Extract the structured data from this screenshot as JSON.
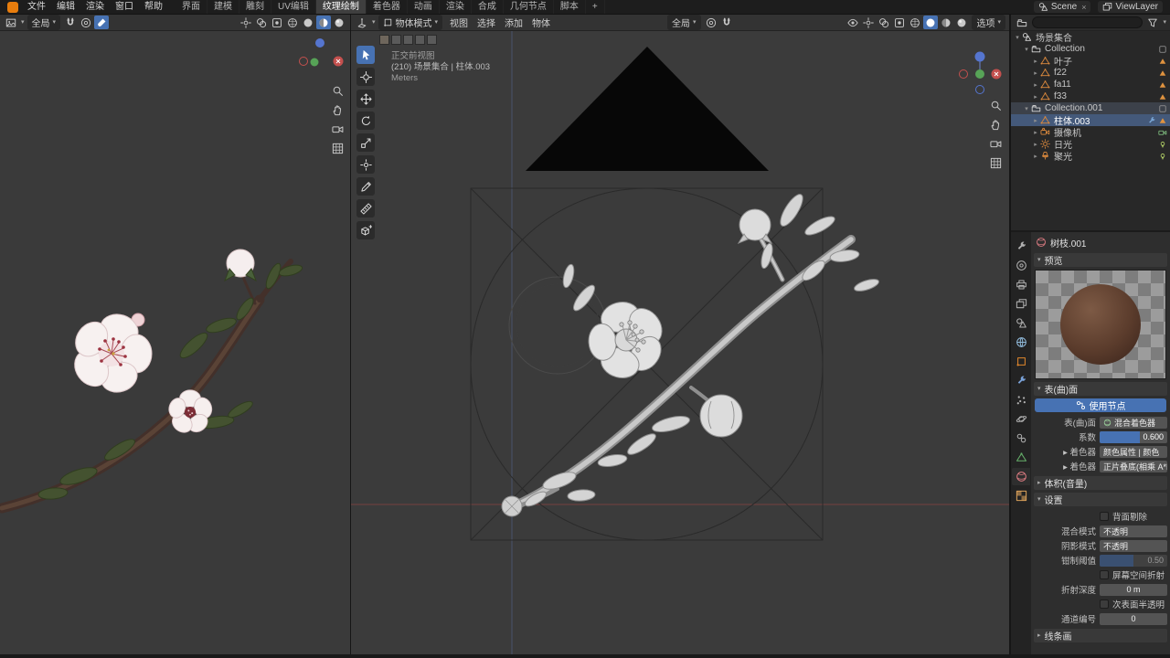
{
  "topbar": {
    "menus": [
      "文件",
      "编辑",
      "渲染",
      "窗口",
      "帮助"
    ],
    "workspaces": [
      "界面",
      "建模",
      "雕刻",
      "UV编辑",
      "纹理绘制",
      "着色器",
      "动画",
      "渲染",
      "合成",
      "几何节点",
      "脚本",
      "+"
    ],
    "active_workspace": "纹理绘制",
    "scene_label": "Scene",
    "viewlayer_label": "ViewLayer"
  },
  "left_viewport": {
    "orientation": "全局",
    "header_mid_icons": [
      "snap-magnet",
      "proportional",
      "brush"
    ],
    "header_right_icons": [
      "gizmo",
      "overlays",
      "xray",
      "shading-wireframe",
      "shading-solid",
      "shading-material",
      "shading-rendered"
    ],
    "active_icons": [
      "brush",
      "shading-material"
    ],
    "nav_icons": [
      "zoom",
      "pan",
      "camera",
      "grid"
    ]
  },
  "right_viewport": {
    "mode": "物体模式",
    "menus": [
      "视图",
      "选择",
      "添加",
      "物体"
    ],
    "orientation": "全局",
    "options_label": "选项",
    "header_mid_icons": [
      "proportional",
      "snap-magnet"
    ],
    "header_right_icons": [
      "eye",
      "gizmo",
      "overlays",
      "xray",
      "shading-wireframe",
      "shading-solid",
      "shading-material",
      "shading-rendered"
    ],
    "active_icons": [
      "shading-solid"
    ],
    "nav_icons": [
      "zoom",
      "pan",
      "camera",
      "grid"
    ],
    "tools": [
      "tweak",
      "cursor",
      "move",
      "rotate",
      "scale",
      "transform",
      "annotate",
      "measure",
      "add-cube"
    ],
    "active_tool_index": 0,
    "paint_slots": 5,
    "info_line1": "正交前视图",
    "info_line2": "(210) 场景集合 | 柱体.003",
    "info_line3": "Meters"
  },
  "outliner": {
    "rows": [
      {
        "label": "场景集合",
        "depth": 0,
        "icon": "scene",
        "exp": "open",
        "right": []
      },
      {
        "label": "Collection",
        "depth": 1,
        "icon": "collection",
        "exp": "open",
        "right": [
          "checkbox"
        ]
      },
      {
        "label": "叶子",
        "depth": 2,
        "icon": "mesh",
        "exp": "leaf",
        "right": [
          "mesh-data"
        ]
      },
      {
        "label": "f22",
        "depth": 2,
        "icon": "mesh",
        "exp": "leaf",
        "right": [
          "mesh-data"
        ]
      },
      {
        "label": "fa11",
        "depth": 2,
        "icon": "mesh",
        "exp": "leaf",
        "right": [
          "mesh-data"
        ]
      },
      {
        "label": "f33",
        "depth": 2,
        "icon": "mesh",
        "exp": "leaf",
        "right": [
          "mesh-data"
        ]
      },
      {
        "label": "Collection.001",
        "depth": 1,
        "icon": "collection",
        "exp": "open",
        "hl": "soft",
        "right": [
          "checkbox"
        ]
      },
      {
        "label": "柱体.003",
        "depth": 2,
        "icon": "mesh",
        "exp": "leaf",
        "hl": "active",
        "right": [
          "modifier",
          "mesh-data"
        ]
      },
      {
        "label": "摄像机",
        "depth": 2,
        "icon": "camera-obj",
        "exp": "leaf",
        "right": [
          "camera-data"
        ]
      },
      {
        "label": "日光",
        "depth": 2,
        "icon": "sun",
        "exp": "leaf",
        "right": [
          "light-data"
        ]
      },
      {
        "label": "聚光",
        "depth": 2,
        "icon": "spot",
        "exp": "leaf",
        "right": [
          "light-data"
        ]
      }
    ]
  },
  "properties": {
    "tabs": [
      "tool",
      "render",
      "output",
      "viewlayer",
      "scene",
      "world",
      "object",
      "modifiers",
      "particles",
      "physics",
      "constraints",
      "data",
      "material",
      "texture"
    ],
    "active_tab": "material",
    "breadcr_icon": "material",
    "breadcrumb": "树枝.001",
    "preview_label": "预览",
    "surface_label": "表(曲)面",
    "use_nodes_label": "使用节点",
    "surface_rows": [
      {
        "type": "dropdown",
        "label": "表(曲)面",
        "value": "混合着色器",
        "icon": "material"
      },
      {
        "type": "slider",
        "label": "系数",
        "value": "0.600",
        "fill": 0.6
      },
      {
        "type": "dropdown",
        "label": "着色器",
        "value": "颜色属性 | 颜色",
        "chevron": true
      },
      {
        "type": "dropdown",
        "label": "着色器",
        "value": "正片叠底(相乘 A*B",
        "chevron": true
      }
    ],
    "volume_label": "体积(音量)",
    "settings_label": "设置",
    "settings_rows": [
      {
        "type": "check",
        "label": "背面剔除",
        "checked": false
      },
      {
        "type": "dropdown",
        "label": "混合模式",
        "value": "不透明"
      },
      {
        "type": "dropdown",
        "label": "阴影模式",
        "value": "不透明"
      },
      {
        "type": "slider",
        "label": "钳制阈值",
        "value": "0.50",
        "fill": 0.5,
        "disabled": true
      },
      {
        "type": "check",
        "label": "屏幕空间折射",
        "checked": false
      },
      {
        "type": "number",
        "label": "折射深度",
        "value": "0 m"
      },
      {
        "type": "check",
        "label": "次表面半透明",
        "checked": false
      },
      {
        "type": "number",
        "label": "通道编号",
        "value": "0"
      }
    ],
    "lineart_label": "线条画"
  }
}
